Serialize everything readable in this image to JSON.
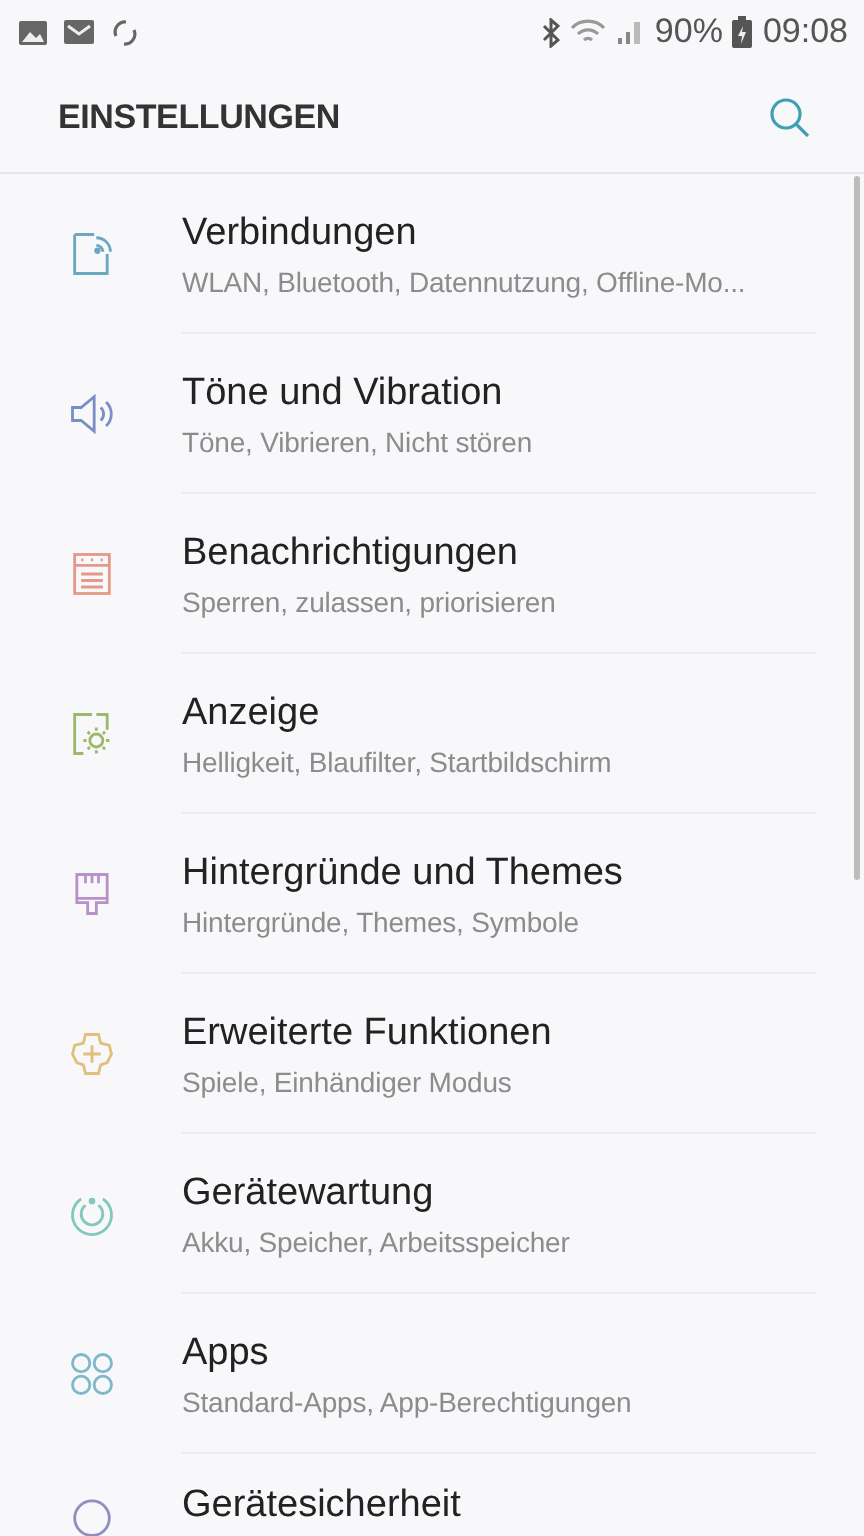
{
  "status_bar": {
    "battery": "90%",
    "time": "09:08"
  },
  "header": {
    "title": "EINSTELLUNGEN"
  },
  "items": [
    {
      "title": "Verbindungen",
      "subtitle": "WLAN, Bluetooth, Datennutzung, Offline-Mo...",
      "color": "#6aa8c0"
    },
    {
      "title": "Töne und Vibration",
      "subtitle": "Töne, Vibrieren, Nicht stören",
      "color": "#7b8fc7"
    },
    {
      "title": "Benachrichtigungen",
      "subtitle": "Sperren, zulassen, priorisieren",
      "color": "#e39a8a"
    },
    {
      "title": "Anzeige",
      "subtitle": "Helligkeit, Blaufilter, Startbildschirm",
      "color": "#9cb86a"
    },
    {
      "title": "Hintergründe und Themes",
      "subtitle": "Hintergründe, Themes, Symbole",
      "color": "#b792c9"
    },
    {
      "title": "Erweiterte Funktionen",
      "subtitle": "Spiele, Einhändiger Modus",
      "color": "#e0c07a"
    },
    {
      "title": "Gerätewartung",
      "subtitle": "Akku, Speicher, Arbeitsspeicher",
      "color": "#7fc9bd"
    },
    {
      "title": "Apps",
      "subtitle": "Standard-Apps, App-Berechtigungen",
      "color": "#7fb8c9"
    },
    {
      "title": "Gerätesicherheit",
      "color": "#8f8fc0"
    }
  ]
}
